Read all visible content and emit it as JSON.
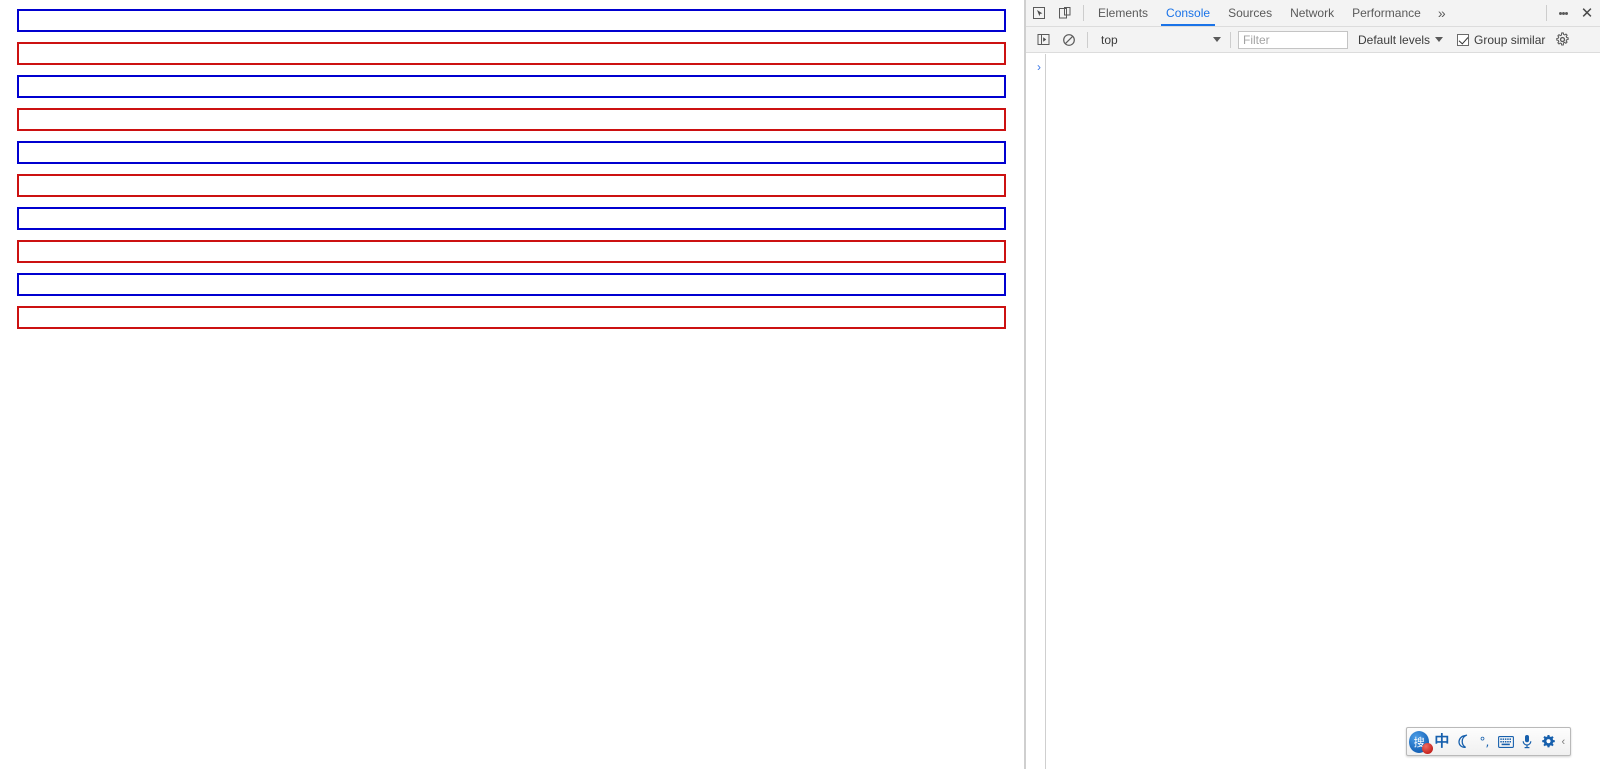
{
  "page": {
    "name": "blank-page-with-bars",
    "bars": [
      {
        "index": 1,
        "color_name": "blue",
        "color": "#0000d0"
      },
      {
        "index": 2,
        "color_name": "red",
        "color": "#cc1111"
      },
      {
        "index": 3,
        "color_name": "blue",
        "color": "#0000d0"
      },
      {
        "index": 4,
        "color_name": "red",
        "color": "#cc1111"
      },
      {
        "index": 5,
        "color_name": "blue",
        "color": "#0000d0"
      },
      {
        "index": 6,
        "color_name": "red",
        "color": "#cc1111"
      },
      {
        "index": 7,
        "color_name": "blue",
        "color": "#0000d0"
      },
      {
        "index": 8,
        "color_name": "red",
        "color": "#cc1111"
      },
      {
        "index": 9,
        "color_name": "blue",
        "color": "#0000d0"
      },
      {
        "index": 10,
        "color_name": "red",
        "color": "#cc1111"
      }
    ]
  },
  "devtools": {
    "toolbar_icons": [
      {
        "name": "inspect-element-icon"
      },
      {
        "name": "device-toolbar-icon"
      }
    ],
    "tabs": [
      {
        "label": "Elements",
        "active": false
      },
      {
        "label": "Console",
        "active": true
      },
      {
        "label": "Sources",
        "active": false
      },
      {
        "label": "Network",
        "active": false
      },
      {
        "label": "Performance",
        "active": false
      }
    ],
    "more_tabs_label": "»",
    "customize_label": "⋮",
    "close_label": "✕",
    "active_tab_color": "#1a73e8",
    "console": {
      "sidebar_toggle_icon": "console-sidebar-icon",
      "clear_icon": "clear-console-icon",
      "context": "top",
      "filter_placeholder": "Filter",
      "filter_value": "",
      "levels_label": "Default levels",
      "group_similar_label": "Group similar",
      "group_similar_checked": true,
      "settings_icon": "console-settings-gear-icon",
      "prompt_symbol": "›",
      "prompt_value": "",
      "messages": []
    }
  },
  "ime": {
    "name": "sogou-input-method-toolbar",
    "logo_text": "搜",
    "items": [
      {
        "name": "ime-mode-chinese",
        "glyph": "中"
      },
      {
        "name": "ime-punctuation",
        "glyph": "月"
      },
      {
        "name": "ime-halfwidth",
        "glyph": "°,"
      },
      {
        "name": "ime-soft-keyboard",
        "glyph": "⌨"
      },
      {
        "name": "ime-voice-input",
        "glyph": "⚙"
      },
      {
        "name": "ime-settings",
        "glyph": "⚙"
      }
    ],
    "chevron": "‹"
  }
}
